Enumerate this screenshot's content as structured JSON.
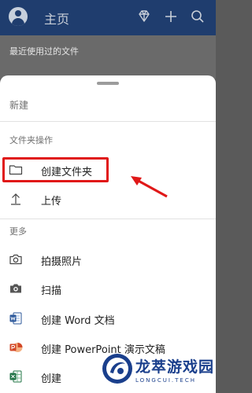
{
  "header": {
    "title": "主页",
    "icons": [
      "avatar",
      "diamond-icon",
      "plus-icon",
      "search-icon"
    ]
  },
  "background": {
    "recent_label": "最近使用过的文件"
  },
  "sheet": {
    "title": "新建",
    "folder_section": {
      "title": "文件夹操作",
      "items": [
        {
          "icon": "folder-icon",
          "label": "创建文件夹"
        },
        {
          "icon": "upload-icon",
          "label": "上传"
        }
      ]
    },
    "more_section": {
      "title": "更多",
      "items": [
        {
          "icon": "camera-icon",
          "label": "拍摄照片"
        },
        {
          "icon": "scan-camera-icon",
          "label": "扫描"
        },
        {
          "icon": "word-icon",
          "label": "创建 Word 文档"
        },
        {
          "icon": "powerpoint-icon",
          "label": "创建 PowerPoint 演示文稿"
        },
        {
          "icon": "excel-icon",
          "label": "创建"
        }
      ]
    }
  },
  "colors": {
    "header_bg": "#1f3d6e",
    "highlight": "#e01818",
    "word": "#2b579a",
    "powerpoint": "#d24726",
    "excel": "#217346"
  },
  "watermark": {
    "text": "龙萃游戏园",
    "sub": "LONGCUI.TECH"
  }
}
